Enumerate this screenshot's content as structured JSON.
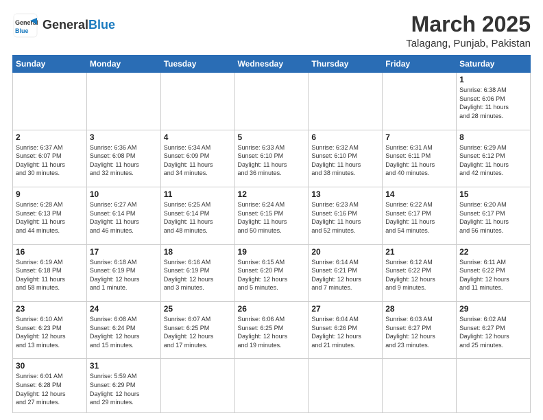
{
  "header": {
    "logo_general": "General",
    "logo_blue": "Blue",
    "month": "March 2025",
    "location": "Talagang, Punjab, Pakistan"
  },
  "days_of_week": [
    "Sunday",
    "Monday",
    "Tuesday",
    "Wednesday",
    "Thursday",
    "Friday",
    "Saturday"
  ],
  "weeks": [
    [
      {
        "day": "",
        "info": ""
      },
      {
        "day": "",
        "info": ""
      },
      {
        "day": "",
        "info": ""
      },
      {
        "day": "",
        "info": ""
      },
      {
        "day": "",
        "info": ""
      },
      {
        "day": "",
        "info": ""
      },
      {
        "day": "1",
        "info": "Sunrise: 6:38 AM\nSunset: 6:06 PM\nDaylight: 11 hours\nand 28 minutes."
      }
    ],
    [
      {
        "day": "2",
        "info": "Sunrise: 6:37 AM\nSunset: 6:07 PM\nDaylight: 11 hours\nand 30 minutes."
      },
      {
        "day": "3",
        "info": "Sunrise: 6:36 AM\nSunset: 6:08 PM\nDaylight: 11 hours\nand 32 minutes."
      },
      {
        "day": "4",
        "info": "Sunrise: 6:34 AM\nSunset: 6:09 PM\nDaylight: 11 hours\nand 34 minutes."
      },
      {
        "day": "5",
        "info": "Sunrise: 6:33 AM\nSunset: 6:10 PM\nDaylight: 11 hours\nand 36 minutes."
      },
      {
        "day": "6",
        "info": "Sunrise: 6:32 AM\nSunset: 6:10 PM\nDaylight: 11 hours\nand 38 minutes."
      },
      {
        "day": "7",
        "info": "Sunrise: 6:31 AM\nSunset: 6:11 PM\nDaylight: 11 hours\nand 40 minutes."
      },
      {
        "day": "8",
        "info": "Sunrise: 6:29 AM\nSunset: 6:12 PM\nDaylight: 11 hours\nand 42 minutes."
      }
    ],
    [
      {
        "day": "9",
        "info": "Sunrise: 6:28 AM\nSunset: 6:13 PM\nDaylight: 11 hours\nand 44 minutes."
      },
      {
        "day": "10",
        "info": "Sunrise: 6:27 AM\nSunset: 6:14 PM\nDaylight: 11 hours\nand 46 minutes."
      },
      {
        "day": "11",
        "info": "Sunrise: 6:25 AM\nSunset: 6:14 PM\nDaylight: 11 hours\nand 48 minutes."
      },
      {
        "day": "12",
        "info": "Sunrise: 6:24 AM\nSunset: 6:15 PM\nDaylight: 11 hours\nand 50 minutes."
      },
      {
        "day": "13",
        "info": "Sunrise: 6:23 AM\nSunset: 6:16 PM\nDaylight: 11 hours\nand 52 minutes."
      },
      {
        "day": "14",
        "info": "Sunrise: 6:22 AM\nSunset: 6:17 PM\nDaylight: 11 hours\nand 54 minutes."
      },
      {
        "day": "15",
        "info": "Sunrise: 6:20 AM\nSunset: 6:17 PM\nDaylight: 11 hours\nand 56 minutes."
      }
    ],
    [
      {
        "day": "16",
        "info": "Sunrise: 6:19 AM\nSunset: 6:18 PM\nDaylight: 11 hours\nand 58 minutes."
      },
      {
        "day": "17",
        "info": "Sunrise: 6:18 AM\nSunset: 6:19 PM\nDaylight: 12 hours\nand 1 minute."
      },
      {
        "day": "18",
        "info": "Sunrise: 6:16 AM\nSunset: 6:19 PM\nDaylight: 12 hours\nand 3 minutes."
      },
      {
        "day": "19",
        "info": "Sunrise: 6:15 AM\nSunset: 6:20 PM\nDaylight: 12 hours\nand 5 minutes."
      },
      {
        "day": "20",
        "info": "Sunrise: 6:14 AM\nSunset: 6:21 PM\nDaylight: 12 hours\nand 7 minutes."
      },
      {
        "day": "21",
        "info": "Sunrise: 6:12 AM\nSunset: 6:22 PM\nDaylight: 12 hours\nand 9 minutes."
      },
      {
        "day": "22",
        "info": "Sunrise: 6:11 AM\nSunset: 6:22 PM\nDaylight: 12 hours\nand 11 minutes."
      }
    ],
    [
      {
        "day": "23",
        "info": "Sunrise: 6:10 AM\nSunset: 6:23 PM\nDaylight: 12 hours\nand 13 minutes."
      },
      {
        "day": "24",
        "info": "Sunrise: 6:08 AM\nSunset: 6:24 PM\nDaylight: 12 hours\nand 15 minutes."
      },
      {
        "day": "25",
        "info": "Sunrise: 6:07 AM\nSunset: 6:25 PM\nDaylight: 12 hours\nand 17 minutes."
      },
      {
        "day": "26",
        "info": "Sunrise: 6:06 AM\nSunset: 6:25 PM\nDaylight: 12 hours\nand 19 minutes."
      },
      {
        "day": "27",
        "info": "Sunrise: 6:04 AM\nSunset: 6:26 PM\nDaylight: 12 hours\nand 21 minutes."
      },
      {
        "day": "28",
        "info": "Sunrise: 6:03 AM\nSunset: 6:27 PM\nDaylight: 12 hours\nand 23 minutes."
      },
      {
        "day": "29",
        "info": "Sunrise: 6:02 AM\nSunset: 6:27 PM\nDaylight: 12 hours\nand 25 minutes."
      }
    ],
    [
      {
        "day": "30",
        "info": "Sunrise: 6:01 AM\nSunset: 6:28 PM\nDaylight: 12 hours\nand 27 minutes."
      },
      {
        "day": "31",
        "info": "Sunrise: 5:59 AM\nSunset: 6:29 PM\nDaylight: 12 hours\nand 29 minutes."
      },
      {
        "day": "",
        "info": ""
      },
      {
        "day": "",
        "info": ""
      },
      {
        "day": "",
        "info": ""
      },
      {
        "day": "",
        "info": ""
      },
      {
        "day": "",
        "info": ""
      }
    ]
  ]
}
